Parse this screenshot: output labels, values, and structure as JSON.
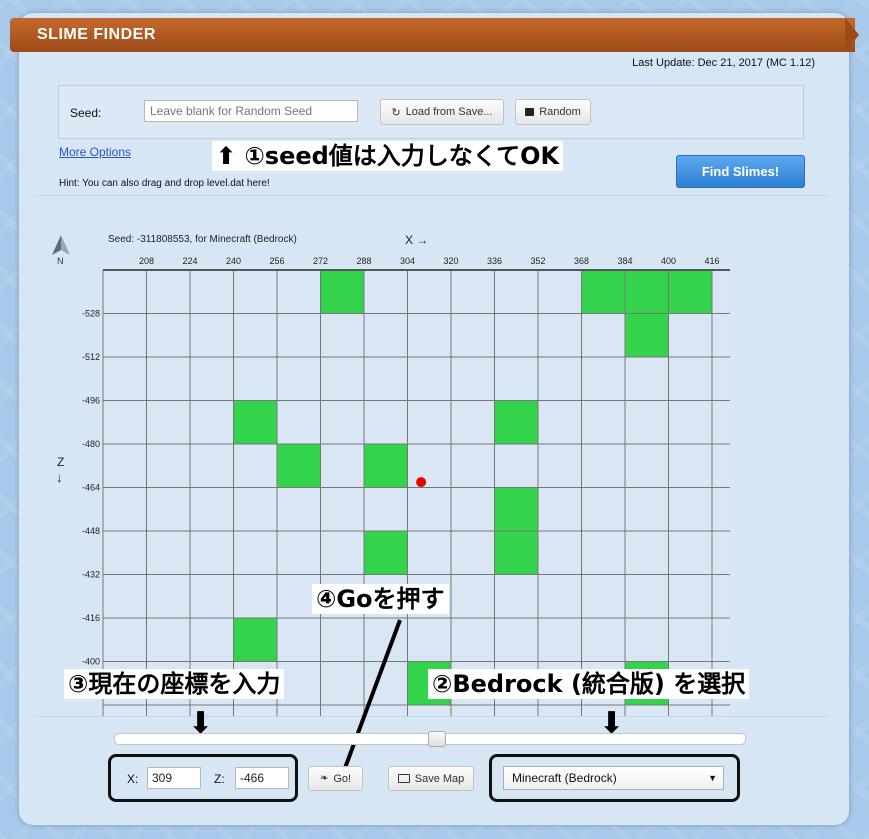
{
  "app": {
    "title": "SLIME FINDER",
    "last_update": "Last Update: Dec 21, 2017 (MC 1.12)"
  },
  "seed_form": {
    "label": "Seed:",
    "placeholder": "Leave blank for Random Seed",
    "load_button": "Load from Save...",
    "random_button": "Random",
    "more_options": "More Options",
    "hint": "Hint: You can also drag and drop level.dat here!",
    "find_button": "Find Slimes!"
  },
  "map": {
    "caption": "Seed: -311808553, for Minecraft (Bedrock)",
    "x_axis_label": "X →",
    "z_axis_label_z": "Z",
    "z_axis_label_arrow": "↓",
    "compass_label": "N",
    "x_ticks": [
      "208",
      "224",
      "240",
      "256",
      "272",
      "288",
      "304",
      "320",
      "336",
      "352",
      "368",
      "384",
      "400",
      "416"
    ],
    "z_ticks": [
      "-528",
      "-512",
      "-496",
      "-480",
      "-464",
      "-448",
      "-432",
      "-416",
      "-400"
    ],
    "slime_chunks": [
      {
        "x": 272,
        "z": -544
      },
      {
        "x": 368,
        "z": -544
      },
      {
        "x": 384,
        "z": -544
      },
      {
        "x": 400,
        "z": -544
      },
      {
        "x": 384,
        "z": -528
      },
      {
        "x": 240,
        "z": -496
      },
      {
        "x": 336,
        "z": -496
      },
      {
        "x": 256,
        "z": -480
      },
      {
        "x": 288,
        "z": -480
      },
      {
        "x": 336,
        "z": -464
      },
      {
        "x": 288,
        "z": -448
      },
      {
        "x": 336,
        "z": -448
      },
      {
        "x": 240,
        "z": -416
      },
      {
        "x": 304,
        "z": -400
      },
      {
        "x": 384,
        "z": -400
      }
    ],
    "player_marker": {
      "x": 309,
      "z": -466
    },
    "colors": {
      "slime": "#33d44b",
      "grid": "#777777",
      "background": "#d9e7f4",
      "marker": "#ee0000"
    }
  },
  "controls": {
    "x_label": "X:",
    "x_value": "309",
    "z_label": "Z:",
    "z_value": "-466",
    "go_button": "Go!",
    "save_map_button": "Save Map",
    "edition_select": "Minecraft (Bedrock)"
  },
  "annotations": {
    "step1": "①seed値は入力しなくてOK",
    "step2": "②Bedrock (統合版) を選択",
    "step3": "③現在の座標を入力",
    "step4": "④Goを押す"
  }
}
